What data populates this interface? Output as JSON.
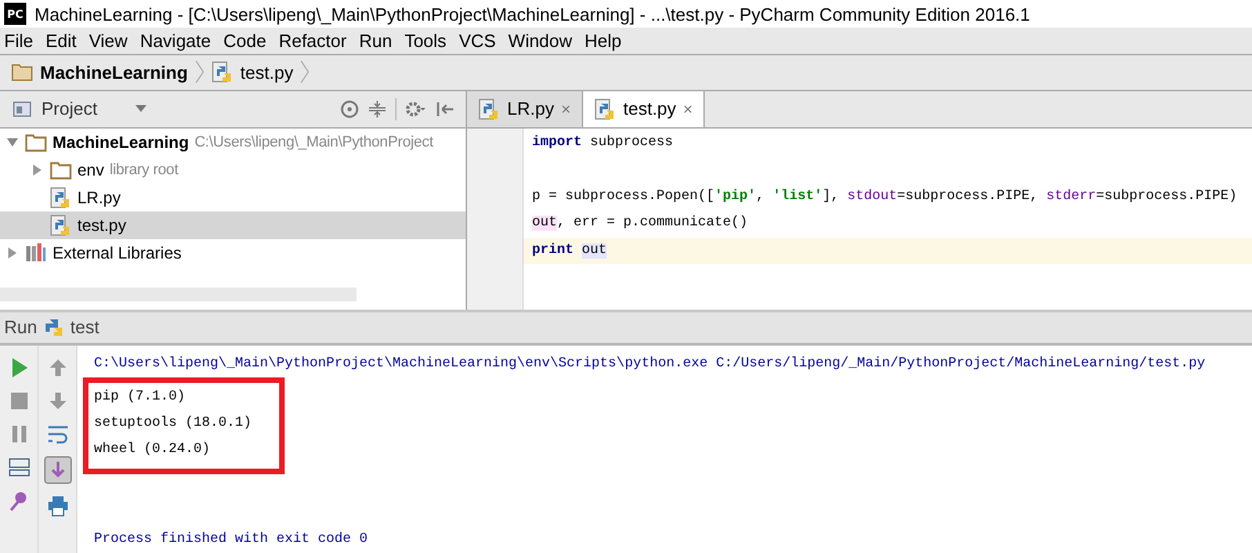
{
  "window": {
    "title": "MachineLearning - [C:\\Users\\lipeng\\_Main\\PythonProject\\MachineLearning] - ...\\test.py - PyCharm Community Edition 2016.1",
    "app_badge": "PC"
  },
  "menu": [
    "File",
    "Edit",
    "View",
    "Navigate",
    "Code",
    "Refactor",
    "Run",
    "Tools",
    "VCS",
    "Window",
    "Help"
  ],
  "breadcrumbs": [
    {
      "label": "MachineLearning",
      "kind": "folder"
    },
    {
      "label": "test.py",
      "kind": "python"
    }
  ],
  "project_panel": {
    "title": "Project",
    "tree": [
      {
        "label": "MachineLearning",
        "hint": "C:\\Users\\lipeng\\_Main\\PythonProject",
        "kind": "folder",
        "bold": true,
        "expanded": true,
        "selected": false,
        "children": [
          {
            "label": "env",
            "hint": "library root",
            "kind": "folder",
            "bold": false,
            "expanded": false,
            "selected": false
          },
          {
            "label": "LR.py",
            "kind": "python",
            "bold": false,
            "selected": false
          },
          {
            "label": "test.py",
            "kind": "python",
            "bold": false,
            "selected": true
          }
        ]
      },
      {
        "label": "External Libraries",
        "kind": "libraries",
        "bold": false,
        "expanded": false,
        "selected": false
      }
    ]
  },
  "editor_tabs": [
    {
      "label": "LR.py",
      "close": "×",
      "selected": false
    },
    {
      "label": "test.py",
      "close": "×",
      "selected": true
    }
  ],
  "code_lines": [
    {
      "current": false,
      "tokens": [
        {
          "text": "import",
          "kind": "keyword"
        },
        {
          "text": " subprocess",
          "kind": "plain"
        }
      ]
    },
    {
      "current": false
    },
    {
      "current": false,
      "tokens": [
        {
          "text": "p = subprocess.Popen([",
          "kind": "plain"
        },
        {
          "text": "'pip'",
          "kind": "string"
        },
        {
          "text": ", ",
          "kind": "plain"
        },
        {
          "text": "'list'",
          "kind": "string"
        },
        {
          "text": "], ",
          "kind": "plain"
        },
        {
          "text": "stdout",
          "kind": "param"
        },
        {
          "text": "=subprocess.PIPE, ",
          "kind": "plain"
        },
        {
          "text": "stderr",
          "kind": "param"
        },
        {
          "text": "=subprocess.PIPE)",
          "kind": "plain"
        }
      ]
    },
    {
      "current": false,
      "tokens": [
        {
          "text": "out",
          "kind": "marked"
        },
        {
          "text": ", err = p.communicate()",
          "kind": "plain"
        }
      ]
    },
    {
      "current": true,
      "tokens": [
        {
          "text": "print ",
          "kind": "keyword"
        },
        {
          "text": "out",
          "kind": "usage"
        }
      ]
    }
  ],
  "run_panel": {
    "title": "Run",
    "config": "test",
    "console": [
      {
        "text": "C:\\Users\\lipeng\\_Main\\PythonProject\\MachineLearning\\env\\Scripts\\python.exe C:/Users/lipeng/_Main/PythonProject/MachineLearning/test.py",
        "kind": "system",
        "highlighted": false
      },
      {
        "text": "pip (7.1.0)",
        "kind": "output",
        "highlighted": true
      },
      {
        "text": "setuptools (18.0.1)",
        "kind": "output",
        "highlighted": true
      },
      {
        "text": "wheel (0.24.0)",
        "kind": "output",
        "highlighted": true
      },
      {
        "text": "Process finished with exit code 0",
        "kind": "exit",
        "highlighted": false
      }
    ]
  }
}
